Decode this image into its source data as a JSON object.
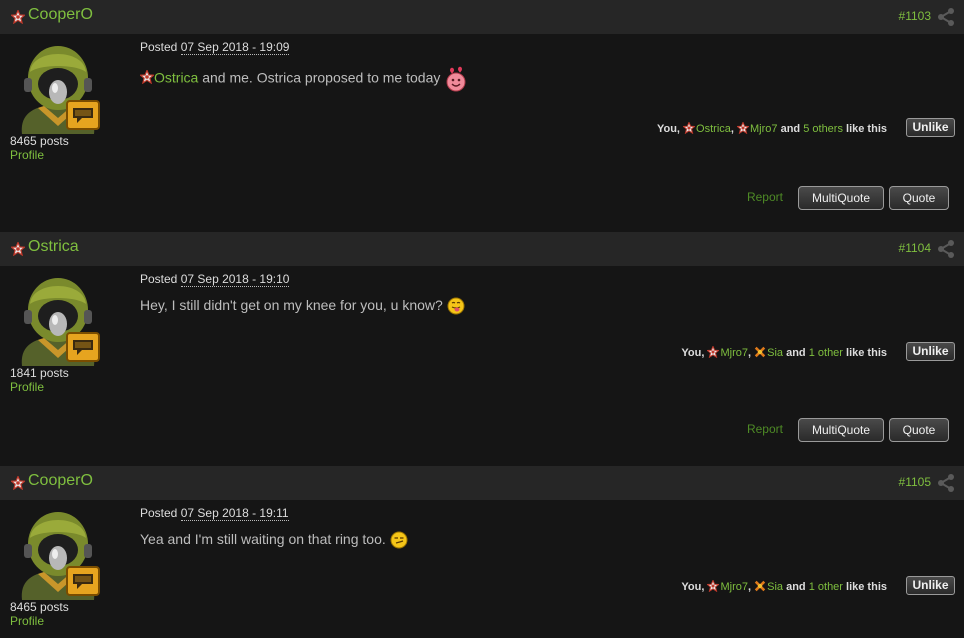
{
  "posts": [
    {
      "author": "CooperO",
      "number": "#1103",
      "posted_label": "Posted",
      "date": "07 Sep 2018 - 19:09",
      "content_mention": "Ostrica",
      "content_text": " and me. Ostrica proposed to me today",
      "post_count": "8465 posts",
      "profile": "Profile",
      "likes": {
        "you": "You,",
        "u1": "Ostrica",
        "sep": ",",
        "u2": "Mjro7",
        "and": "and",
        "others": "5 others",
        "tail": "like this"
      },
      "unlike": "Unlike",
      "report": "Report",
      "multiquote": "MultiQuote",
      "quote": "Quote"
    },
    {
      "author": "Ostrica",
      "number": "#1104",
      "posted_label": "Posted",
      "date": "07 Sep 2018 - 19:10",
      "content_text": "Hey, I still didn't get on my knee for you, u know?",
      "post_count": "1841 posts",
      "profile": "Profile",
      "likes": {
        "you": "You,",
        "u1": "Mjro7",
        "sep": ",",
        "u2": "Sia",
        "and": "and",
        "others": "1 other",
        "tail": "like this"
      },
      "unlike": "Unlike",
      "report": "Report",
      "multiquote": "MultiQuote",
      "quote": "Quote"
    },
    {
      "author": "CooperO",
      "number": "#1105",
      "posted_label": "Posted",
      "date": "07 Sep 2018 - 19:11",
      "content_text": "Yea and I'm still waiting on that ring too.",
      "post_count": "8465 posts",
      "profile": "Profile",
      "likes": {
        "you": "You,",
        "u1": "Mjro7",
        "sep": ",",
        "u2": "Sia",
        "and": "and",
        "others": "1 other",
        "tail": "like this"
      },
      "unlike": "Unlike"
    }
  ],
  "colors": {
    "accent_green": "#7fbf3f",
    "header_bg": "#262626",
    "body_bg": "#151515"
  },
  "icons": [
    "rank-star-icon",
    "share-icon",
    "avatar-soldier-helmet",
    "chat-badge-icon",
    "hearts-emoji-icon",
    "tongue-emoji-icon",
    "smirk-emoji-icon",
    "sia-rank-icon"
  ]
}
